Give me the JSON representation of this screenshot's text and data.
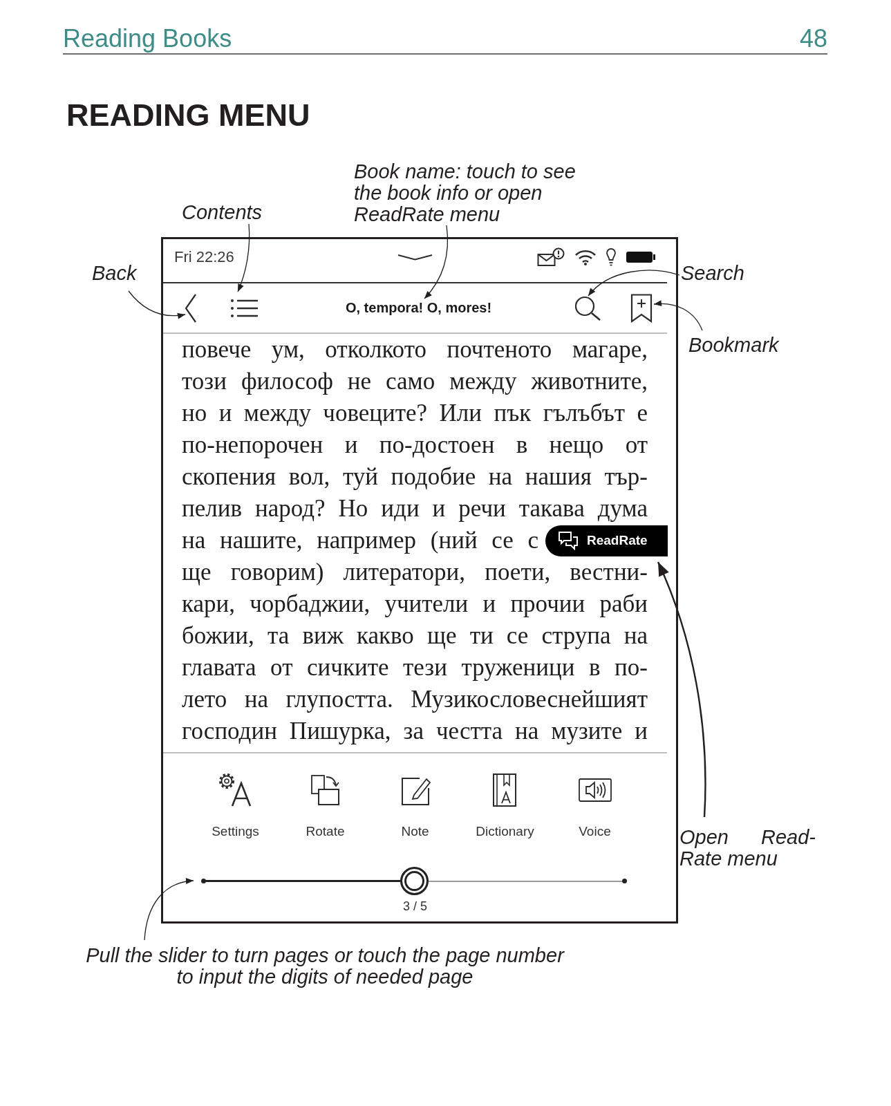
{
  "page_header": {
    "section": "Reading Books",
    "page_number": "48"
  },
  "heading": "READING MENU",
  "callouts": [
    {
      "kind": "contents",
      "lines": [
        "Contents"
      ]
    },
    {
      "kind": "book_name",
      "lines": [
        "Book name: touch to see",
        "the book info or open",
        "ReadRate menu"
      ]
    },
    {
      "kind": "back",
      "lines": [
        "Back"
      ]
    },
    {
      "kind": "search",
      "lines": [
        "Search"
      ]
    },
    {
      "kind": "bookmark",
      "lines": [
        "Bookmark"
      ]
    },
    {
      "kind": "readrate",
      "lines": [
        "Open Read-",
        "Rate menu"
      ]
    },
    {
      "kind": "slider",
      "lines": [
        "Pull the slider to turn pages or touch the page number",
        "to input the digits of needed page"
      ]
    }
  ],
  "device": {
    "status_bar": {
      "time": "Fri 22:26"
    },
    "toolbar": {
      "book_title": "O, tempora! O, mores!"
    },
    "page_text": {
      "lines": [
        {
          "text": "повече ум, отколкото почтеното магаре,"
        },
        {
          "text": "този философ не само между животните,"
        },
        {
          "text": "но и между човеците? Или пък гълъбът е"
        },
        {
          "text": "по-непорочен и по-достоен в нещо от"
        },
        {
          "text": "скопения вол, туй подобие на нашия тър-"
        },
        {
          "text": "пелив народ? Но иди и речи такава дума"
        },
        {
          "text": "на нашите, например (ний се с",
          "badge": "ReadRate"
        },
        {
          "text": "ще говорим) литератори, поети, вестни-"
        },
        {
          "text": "кари, чорбаджии, учители и прочии раби"
        },
        {
          "text": "божии, та виж какво ще ти се струпа на"
        },
        {
          "text": "главата от сичките тези труженици в по-"
        },
        {
          "text": "лето на глупостта. Музикословеснейшият"
        },
        {
          "text": "господин Пишурка, за честта на музите и"
        }
      ]
    },
    "menu": [
      {
        "kind": "settings",
        "label": "Settings"
      },
      {
        "kind": "rotate",
        "label": "Rotate"
      },
      {
        "kind": "note",
        "label": "Note"
      },
      {
        "kind": "dictionary",
        "label": "Dictionary"
      },
      {
        "kind": "voice",
        "label": "Voice"
      }
    ],
    "slider": {
      "level": 0.5,
      "page": "3 / 5"
    }
  }
}
